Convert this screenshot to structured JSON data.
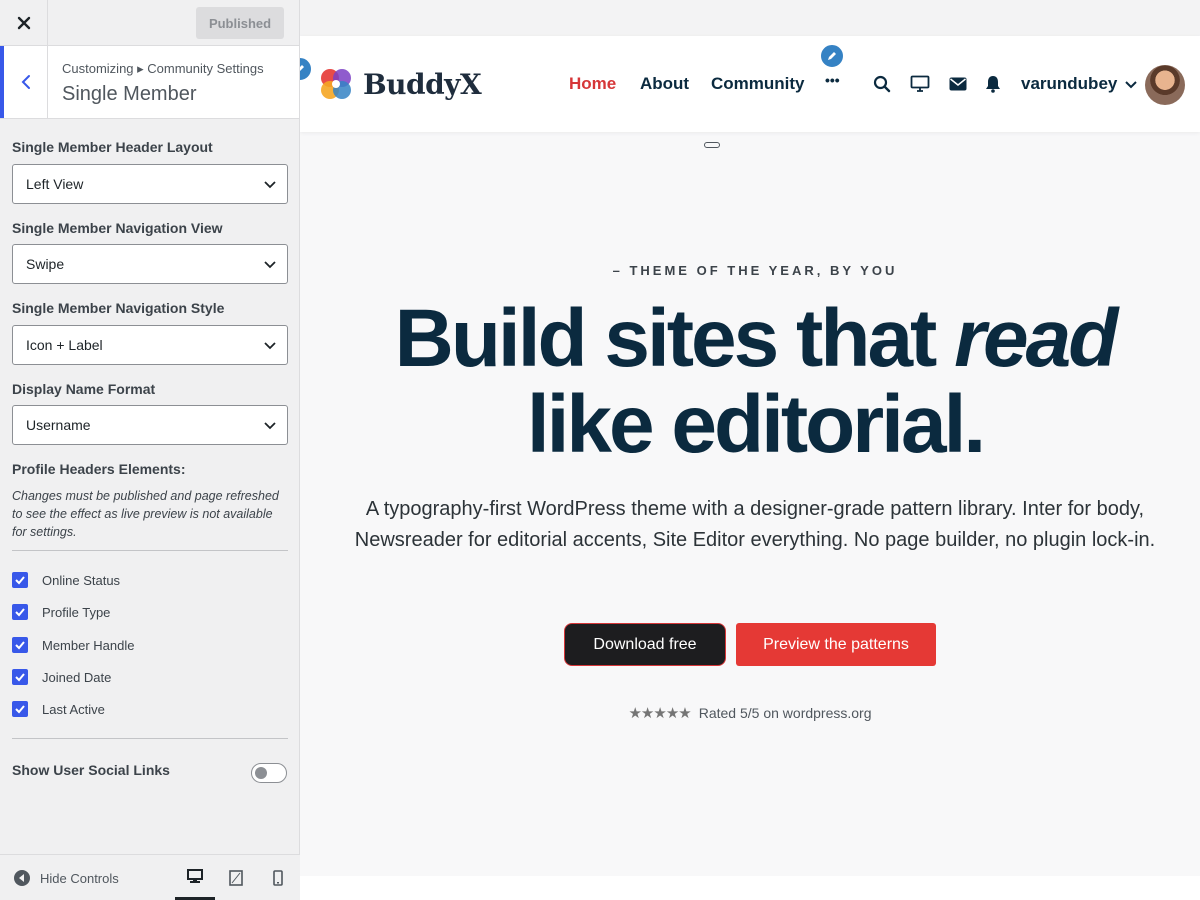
{
  "customizer": {
    "publish_label": "Published",
    "breadcrumb": "Customizing ▸ Community Settings",
    "section_title": "Single Member",
    "controls": [
      {
        "label": "Single Member Header Layout",
        "value": "Left View"
      },
      {
        "label": "Single Member Navigation View",
        "value": "Swipe"
      },
      {
        "label": "Single Member Navigation Style",
        "value": "Icon + Label"
      },
      {
        "label": "Display Name Format",
        "value": "Username"
      }
    ],
    "profile_headers": {
      "title": "Profile Headers Elements:",
      "note": "Changes must be published and page refreshed to see the effect as live preview is not available for settings.",
      "items": [
        {
          "label": "Online Status",
          "checked": true
        },
        {
          "label": "Profile Type",
          "checked": true
        },
        {
          "label": "Member Handle",
          "checked": true
        },
        {
          "label": "Joined Date",
          "checked": true
        },
        {
          "label": "Last Active",
          "checked": true
        }
      ]
    },
    "social_links": {
      "label": "Show User Social Links",
      "enabled": false
    },
    "footer": {
      "hide_controls_label": "Hide Controls",
      "active_device": "desktop"
    }
  },
  "site": {
    "logo_text": "BuddyX",
    "nav": [
      {
        "label": "Home",
        "active": true
      },
      {
        "label": "About",
        "active": false
      },
      {
        "label": "Community",
        "active": false
      },
      {
        "label": "•••",
        "active": false
      }
    ],
    "username": "varundubey",
    "hero": {
      "eyebrow": "– THEME OF THE YEAR, BY YOU",
      "headline_1": "Build sites that ",
      "headline_em": "read",
      "headline_2": "like editorial.",
      "subtitle": "A typography-first WordPress theme with a designer-grade pattern library. Inter for body, Newsreader for editorial accents, Site Editor everything. No page builder, no plugin lock-in.",
      "primary_button": "Download free",
      "secondary_button": "Preview the patterns",
      "rating_stars": "★★★★★",
      "rating_text": "Rated 5/5 on wordpress.org"
    }
  },
  "colors": {
    "accent_blue": "#3858e9",
    "brand_red": "#e53935",
    "nav_active": "#d63638",
    "heading_navy": "#0b2a3f"
  }
}
